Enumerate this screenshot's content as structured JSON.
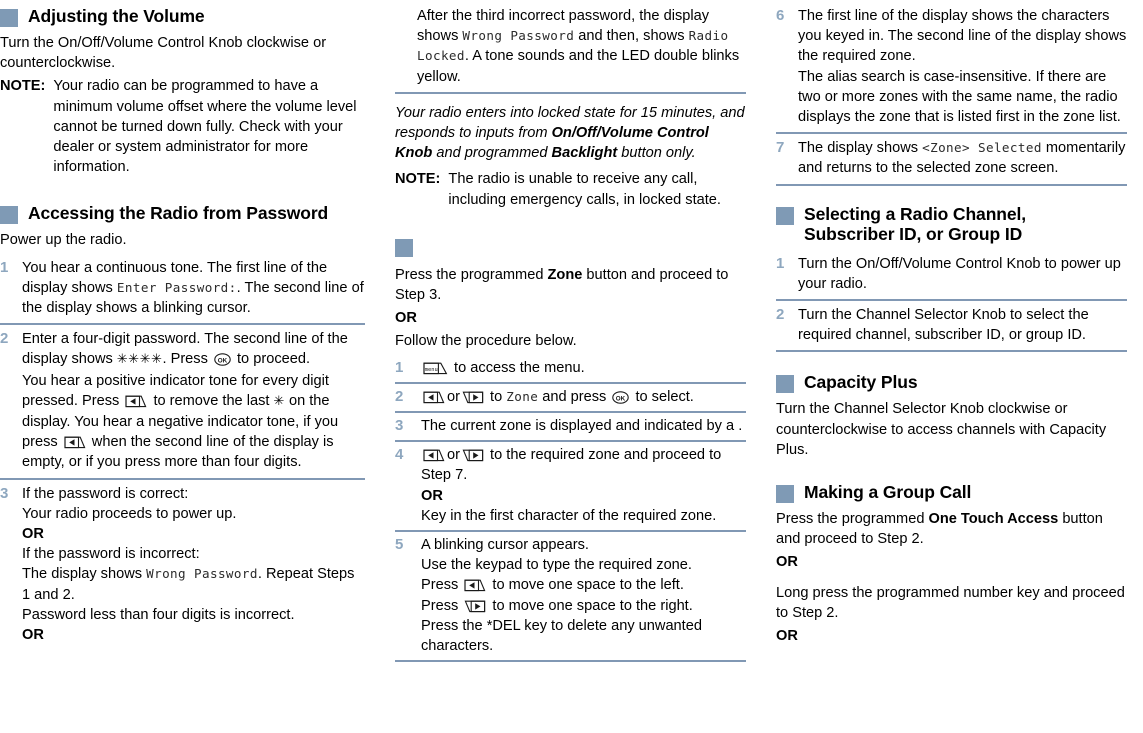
{
  "theme": {
    "accent_square": "#7f9ab5",
    "rule_color": "#8198b4",
    "step_number_color": "#8ea7bf",
    "text_color": "#000000"
  },
  "columns": [
    {
      "id": "column-1",
      "blocks": [
        {
          "type": "heading",
          "text": "Adjusting the Volume"
        },
        {
          "type": "para",
          "text": "Turn the On/Off/Volume Control Knob clockwise or counterclockwise."
        },
        {
          "type": "note",
          "label": "NOTE",
          "colon": ":",
          "text": "Your radio can be programmed to have a minimum volume offset where the volume level cannot be turned down fully. Check with your dealer or system administrator for more information."
        },
        {
          "type": "heading",
          "text": "Accessing the Radio from Password"
        },
        {
          "type": "para",
          "text": "Power up the radio."
        },
        {
          "type": "step",
          "num": "1",
          "lines": [
            "You hear a continuous tone. The first line of the display shows ",
            "Enter Password:",
            ". The second line of the display shows a blinking cursor."
          ]
        },
        {
          "type": "rule"
        },
        {
          "type": "step",
          "num": "2",
          "lines": [
            "Enter a four-digit password. The second line of the display shows ",
            "****",
            ". Press ",
            "OK",
            " to proceed.",
            "You hear a positive indicator tone for every digit pressed. Press ",
            "left-key",
            " to remove the last ",
            "*",
            " on the display. You hear a negative indicator tone, if you press ",
            "left-key",
            " when the second line of the display is empty, or if you press more than four digits."
          ]
        },
        {
          "type": "rule"
        },
        {
          "type": "step",
          "num": "3",
          "lines": [
            "If the password is correct:",
            "Your radio proceeds to power up.",
            "OR",
            "If the password is incorrect:",
            "The display shows ",
            "Wrong Password",
            ". Repeat Steps 1 and 2.",
            "Password less than four digits is incorrect.",
            "OR"
          ]
        }
      ]
    },
    {
      "id": "column-2",
      "blocks": [
        {
          "type": "cont_step",
          "lines": [
            "After the third incorrect password, the display shows ",
            "Wrong Password",
            " and then, shows ",
            "Radio Locked",
            ". A tone sounds and the LED double blinks yellow."
          ]
        },
        {
          "type": "rule"
        },
        {
          "type": "para_italic",
          "segments": [
            {
              "t": "Your radio enters into locked state for 15 minutes, and responds to inputs from ",
              "b": false
            },
            {
              "t": "On/Off/Volume Control Knob",
              "b": true
            },
            {
              "t": " and programmed ",
              "b": false
            },
            {
              "t": "Backlight",
              "b": true
            },
            {
              "t": " button only.",
              "b": false
            }
          ]
        },
        {
          "type": "note",
          "label": "NOTE",
          "colon": ":",
          "text": "The radio is unable to receive any call, including emergency calls, in locked state."
        },
        {
          "type": "heading_empty",
          "text": ""
        },
        {
          "type": "para_mixed",
          "segments": [
            {
              "t": "Press the programmed ",
              "b": false
            },
            {
              "t": "Zone",
              "b": true
            },
            {
              "t": " button and proceed to Step 3.",
              "b": false
            }
          ]
        },
        {
          "type": "or",
          "text": "OR"
        },
        {
          "type": "para",
          "text": "Follow the procedure below."
        },
        {
          "type": "substep",
          "num": "1",
          "icon": "menu-key",
          "text": " to access the menu."
        },
        {
          "type": "rule"
        },
        {
          "type": "substep2",
          "num": "2",
          "pre_icon": "left-key",
          "mid": "or",
          "post_icon": "right-key",
          "text_a": " to ",
          "lcd": "Zone",
          "text_b": " and press ",
          "icon_ok": "OK",
          "text_c": " to select."
        },
        {
          "type": "rule"
        },
        {
          "type": "substep",
          "num": "3",
          "text": "The current zone is displayed and indicated by a ."
        },
        {
          "type": "rule"
        },
        {
          "type": "substep4",
          "num": "4",
          "pre_icon": "left-key",
          "mid": "or",
          "post_icon": "right-key",
          "lines": [
            " to the required zone and proceed to Step 7.",
            "OR",
            "Key in the first character of the required zone."
          ]
        },
        {
          "type": "rule"
        },
        {
          "type": "substep5",
          "num": "5",
          "lines": [
            "A blinking cursor appears.",
            "Use the keypad to type the required zone.",
            "Press |left-key| to move one space to the left.",
            "Press |right-key| to move one space to the right.",
            "Press the *DEL key to delete any unwanted characters."
          ]
        },
        {
          "type": "rule"
        }
      ]
    },
    {
      "id": "column-3",
      "blocks": [
        {
          "type": "step",
          "num": "6",
          "lines": [
            "The first line of the display shows the characters you keyed in. The second line of the display shows the required zone.",
            "The alias search is case-insensitive. If there are two or more zones with the same name, the radio displays the zone that is listed first in the zone list."
          ]
        },
        {
          "type": "rule"
        },
        {
          "type": "step",
          "num": "7",
          "lines": [
            "The display shows ",
            "<Zone> Selected",
            " momentarily and returns to the selected zone screen."
          ]
        },
        {
          "type": "rule"
        },
        {
          "type": "heading2",
          "line1": "Selecting a Radio Channel,",
          "line2": "Subscriber ID, or Group ID"
        },
        {
          "type": "step",
          "num": "1",
          "lines": [
            "Turn the On/Off/Volume Control Knob to power up your radio."
          ]
        },
        {
          "type": "rule"
        },
        {
          "type": "step",
          "num": "2",
          "lines": [
            "Turn the Channel Selector Knob to select the required channel, subscriber ID, or group ID."
          ]
        },
        {
          "type": "rule"
        },
        {
          "type": "heading",
          "text": "Capacity Plus"
        },
        {
          "type": "para",
          "text": "Turn the Channel Selector Knob clockwise or counterclockwise to access channels with Capacity Plus."
        },
        {
          "type": "heading",
          "text": "Making a Group Call"
        },
        {
          "type": "para_mixed",
          "segments": [
            {
              "t": "Press the programmed ",
              "b": false
            },
            {
              "t": "One Touch Access",
              "b": true
            },
            {
              "t": " button and proceed to Step 2.",
              "b": false
            }
          ]
        },
        {
          "type": "or",
          "text": "OR"
        },
        {
          "type": "para",
          "text": "Long press the programmed number key and proceed to Step 2."
        },
        {
          "type": "or",
          "text": "OR"
        }
      ]
    }
  ],
  "strings": {
    "c1": {
      "h1": "Adjusting the Volume",
      "p1": "Turn the On/Off/Volume Control Knob clockwise or counterclockwise.",
      "note_label": "NOTE",
      "note_colon": ":",
      "note_text": "Your radio can be programmed to have a minimum volume offset where the volume level cannot be turned down fully. Check with your dealer or system administrator for more information.",
      "h2": "Accessing the Radio from Password",
      "p2": "Power up the radio.",
      "s1_num": "1",
      "s1_a": "You hear a continuous tone. The first line of the display shows ",
      "s1_lcd": "Enter Password:",
      "s1_b": ". The second line of the display shows a blinking cursor.",
      "s2_num": "2",
      "s2_a": "Enter a four-digit password. The second line of the display shows ",
      "s2_stars": "✳✳✳✳",
      "s2_b": ". Press ",
      "s2_c": " to proceed.",
      "s2_d": "You hear a positive indicator tone for every digit pressed. Press ",
      "s2_e": " to remove the last ",
      "s2_star": "✳",
      "s2_f": " on the display. You hear a negative indicator tone, if you press ",
      "s2_g": " when the second line of the display is empty, or if you press more than four digits.",
      "s3_num": "3",
      "s3_l1": "If the password is correct:",
      "s3_l2": "Your radio proceeds to power up.",
      "s3_or1": "OR",
      "s3_l3": "If the password is incorrect:",
      "s3_l4a": "The display shows ",
      "s3_lcd": "Wrong Password",
      "s3_l4b": ". Repeat Steps 1 and 2.",
      "s3_l5": "Password less than four digits is incorrect.",
      "s3_or2": "OR"
    },
    "c2": {
      "t1a": "After the third incorrect password, the display shows ",
      "t1_lcd1": "Wrong Password",
      "t1b": " and then, shows ",
      "t1_lcd2": "Radio Locked",
      "t1c": ". A tone sounds and the LED double blinks yellow.",
      "it_a": "Your radio enters into locked state for 15 minutes, and responds to inputs from ",
      "it_b": "On/Off/Volume Control Knob",
      "it_c": " and programmed ",
      "it_d": "Backlight",
      "it_e": " button only.",
      "note_label": "NOTE",
      "note_colon": ":",
      "note_text": "The radio is unable to receive any call, including emergency calls, in locked state.",
      "zp_a": "Press the programmed ",
      "zp_b": "Zone",
      "zp_c": " button and proceed to Step 3.",
      "or1": "OR",
      "p_follow": "Follow the procedure below.",
      "n1": "1",
      "n1_text": " to access the menu.",
      "n2": "2",
      "n2_or": "or",
      "n2_a": " to ",
      "n2_lcd": "Zone",
      "n2_b": " and press ",
      "n2_c": " to select.",
      "n3": "3",
      "n3_text": "The current zone is displayed and indicated by a .",
      "n4": "4",
      "n4_or": "or",
      "n4_a": " to the required zone and proceed to Step 7.",
      "n4_or2": "OR",
      "n4_b": "Key in the first character of the required zone.",
      "n5": "5",
      "n5_l1": "A blinking cursor appears.",
      "n5_l2": "Use the keypad to type the required zone.",
      "n5_l3a": "Press ",
      "n5_l3b": " to move one space to the left.",
      "n5_l4a": "Press ",
      "n5_l4b": " to move one space to the right.",
      "n5_l5": "Press the *DEL key to delete any unwanted characters."
    },
    "c3": {
      "s6_num": "6",
      "s6_l1": "The first line of the display shows the characters you keyed in. The second line of the display shows the required zone.",
      "s6_l2": "The alias search is case-insensitive. If there are two or more zones with the same name, the radio displays the zone that is listed first in the zone list.",
      "s7_num": "7",
      "s7_a": "The display shows ",
      "s7_lcd": "<Zone> Selected",
      "s7_b": " momentarily and returns to the selected zone screen.",
      "h1_l1": "Selecting a Radio Channel,",
      "h1_l2": "Subscriber ID, or Group ID",
      "c1_num": "1",
      "c1_text": "Turn the On/Off/Volume Control Knob to power up your radio.",
      "c2_num": "2",
      "c2_text": "Turn the Channel Selector Knob to select the required channel, subscriber ID, or group ID.",
      "h2": "Capacity Plus",
      "p_cap": "Turn the Channel Selector Knob clockwise or counterclockwise to access channels with Capacity Plus.",
      "h3": "Making a Group Call",
      "g_a": "Press the programmed ",
      "g_b": "One Touch Access",
      "g_c": " button and proceed to Step 2.",
      "g_or1": "OR",
      "g_l2": "Long press the programmed number key and proceed to Step 2.",
      "g_or2": "OR"
    },
    "icons": {
      "menu_key": "menu",
      "ok_key": "OK",
      "left_key": "left-arrow",
      "right_key": "right-arrow"
    }
  }
}
